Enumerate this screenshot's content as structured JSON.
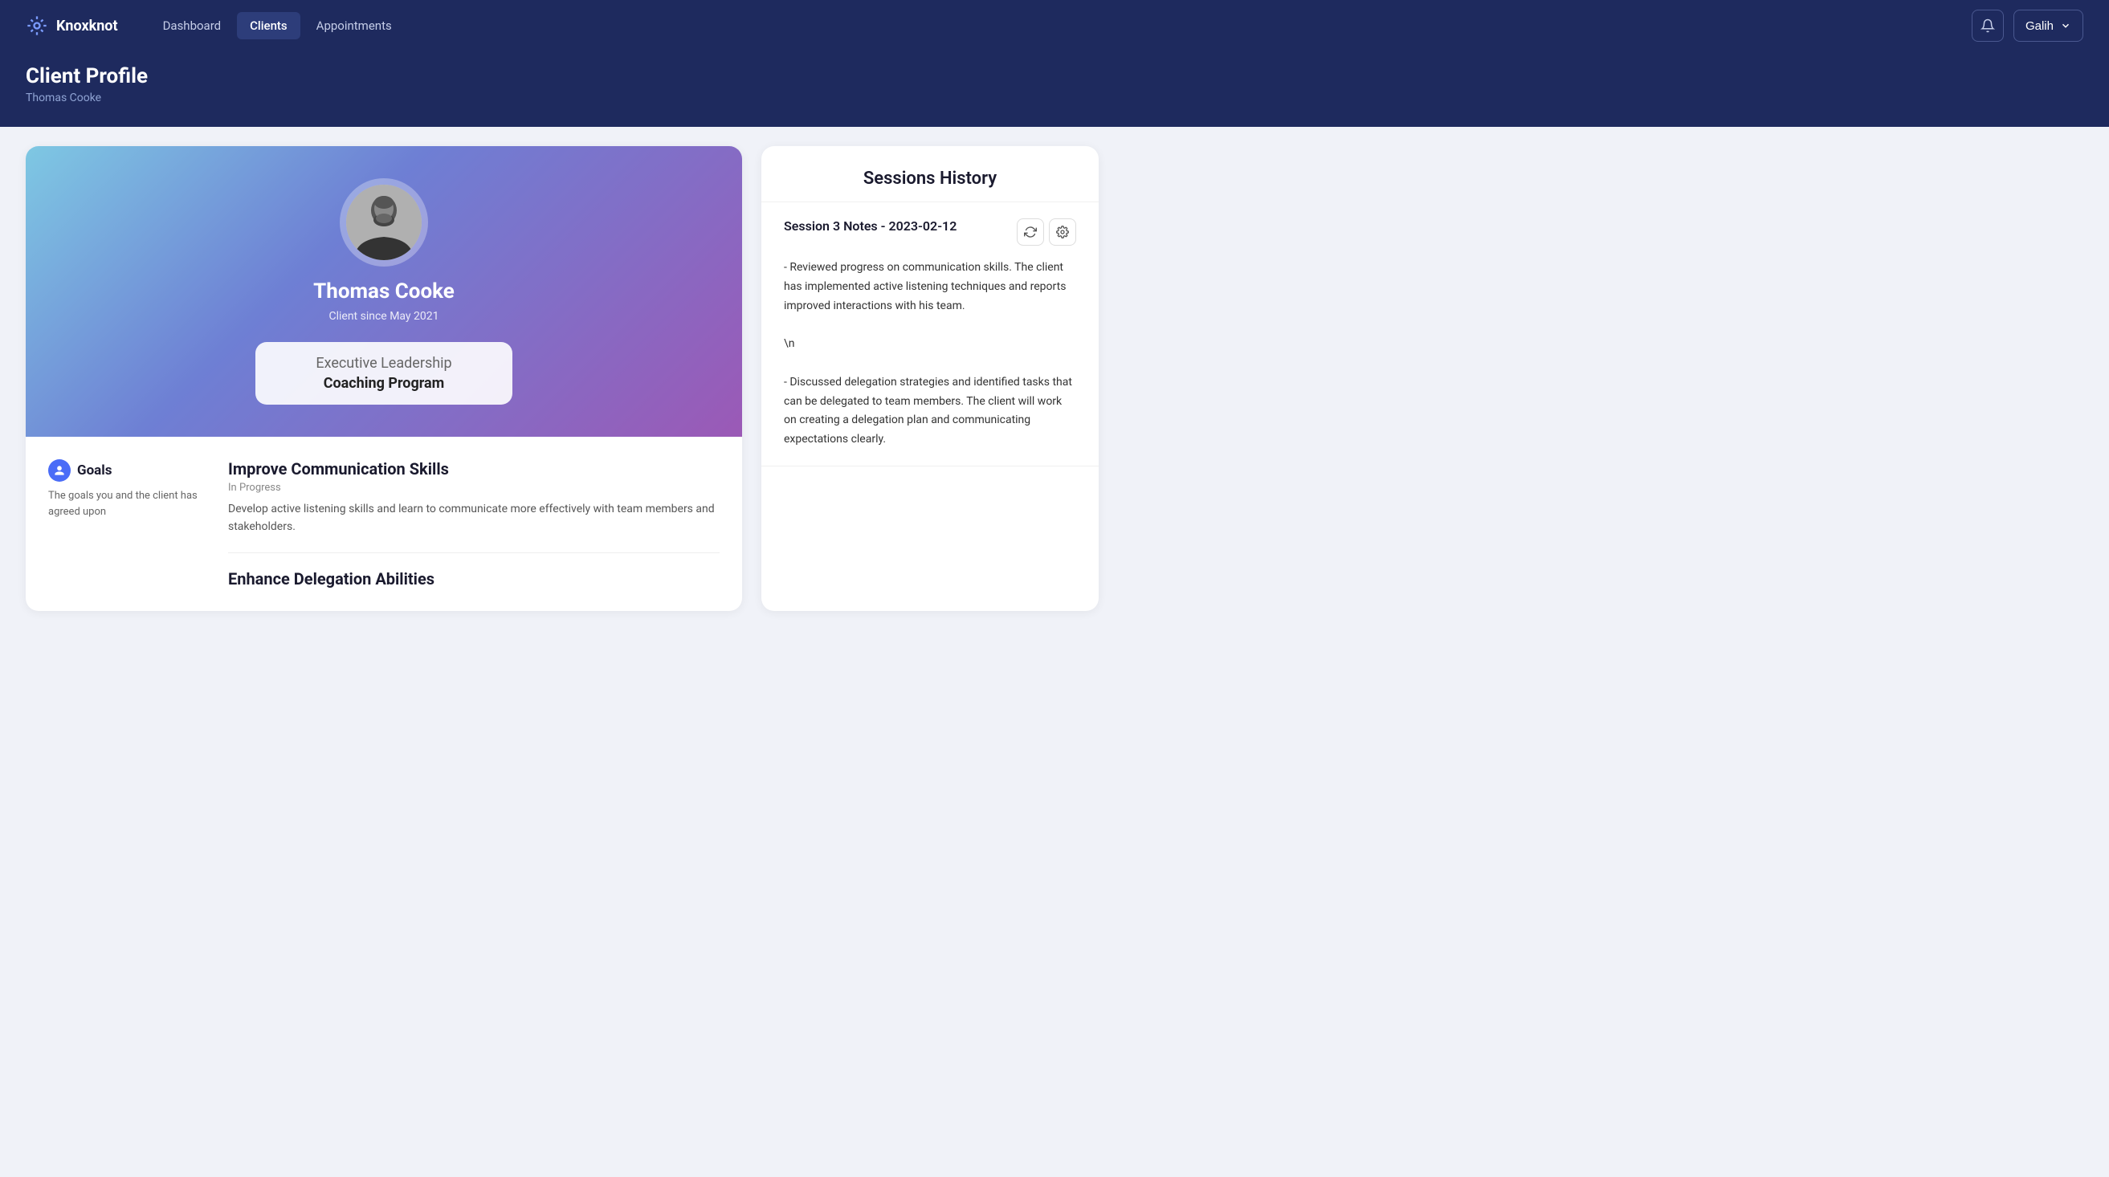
{
  "nav": {
    "brand": "Knoxknot",
    "links": [
      {
        "label": "Dashboard",
        "active": false
      },
      {
        "label": "Clients",
        "active": true
      },
      {
        "label": "Appointments",
        "active": false
      }
    ],
    "user": "Galih"
  },
  "page": {
    "title": "Client Profile",
    "subtitle": "Thomas Cooke"
  },
  "profile": {
    "name": "Thomas Cooke",
    "since": "Client since May 2021",
    "program_line1": "Executive Leadership",
    "program_line2": "Coaching Program"
  },
  "goals": {
    "label": "Goals",
    "description": "The goals you and the client has agreed upon",
    "items": [
      {
        "title": "Improve Communication Skills",
        "status": "In Progress",
        "detail": "Develop active listening skills and learn to communicate more effectively with team members and stakeholders."
      },
      {
        "title": "Enhance Delegation Abilities",
        "status": "",
        "detail": ""
      }
    ]
  },
  "sessions": {
    "title": "Sessions History",
    "entries": [
      {
        "title": "Session 3 Notes - 2023-02-12",
        "notes": "- Reviewed progress on communication skills. The client has implemented active listening techniques and reports improved interactions with his team.\n\n\\n\n\n- Discussed delegation strategies and identified tasks that can be delegated to team members. The client will work on creating a delegation plan and communicating expectations clearly."
      }
    ]
  }
}
